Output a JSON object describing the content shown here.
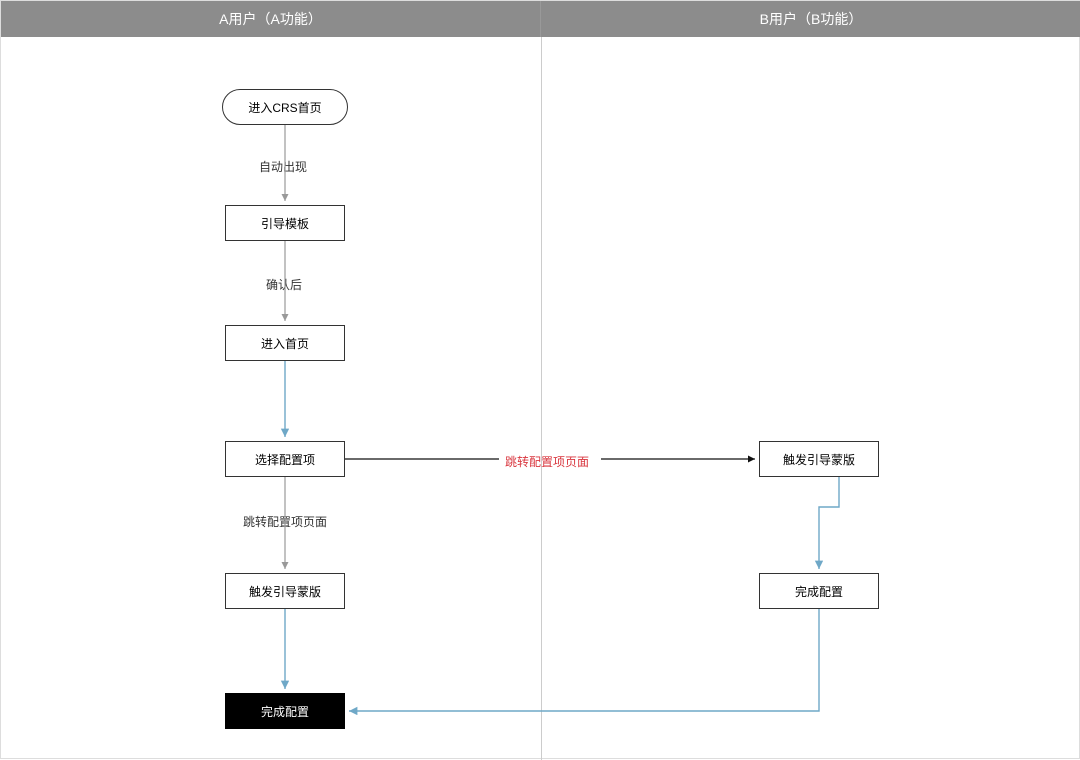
{
  "lanes": {
    "left": "A用户（A功能）",
    "right": "B用户（B功能）"
  },
  "nodes": {
    "start": "进入CRS首页",
    "guide_template": "引导模板",
    "enter_home": "进入首页",
    "select_config": "选择配置项",
    "trigger_guide_left": "触发引导蒙版",
    "finish_config": "完成配置",
    "trigger_guide_right": "触发引导蒙版",
    "finish_config_right": "完成配置"
  },
  "edges": {
    "auto_appear": "自动出现",
    "after_confirm": "确认后",
    "jump_config_page_left": "跳转配置项页面",
    "jump_config_page_center": "跳转配置项页面"
  }
}
